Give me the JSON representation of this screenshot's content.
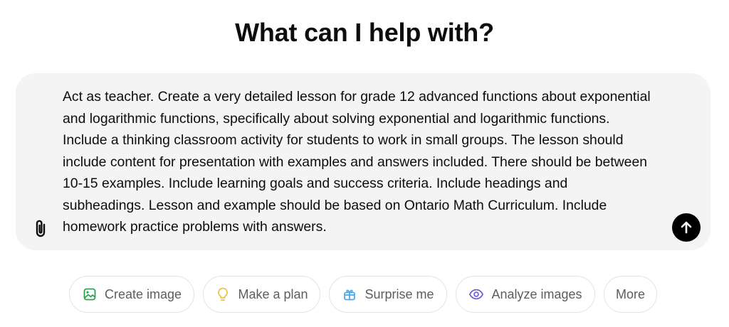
{
  "headline": "What can I help with?",
  "composer": {
    "text": "Act as teacher. Create a very detailed lesson for grade 12 advanced functions about exponential and logarithmic functions, specifically about solving exponential and logarithmic functions. Include a thinking classroom activity for students to work in small groups. The lesson should include content for presentation with examples and answers included. There should be between 10-15 examples. Include learning goals and success criteria. Include headings and subheadings. Lesson and example should be based on Ontario Math Curriculum. Include homework practice problems with answers.",
    "attach_icon": "paperclip-icon",
    "send_icon": "arrow-up-icon"
  },
  "suggestions": [
    {
      "label": "Create image",
      "icon": "image-icon",
      "color": "#2ea44f"
    },
    {
      "label": "Make a plan",
      "icon": "lightbulb-icon",
      "color": "#e2c541"
    },
    {
      "label": "Surprise me",
      "icon": "gift-icon",
      "color": "#4fa9e8"
    },
    {
      "label": "Analyze images",
      "icon": "eye-icon",
      "color": "#6b5bd6"
    },
    {
      "label": "More",
      "icon": "",
      "color": ""
    }
  ]
}
